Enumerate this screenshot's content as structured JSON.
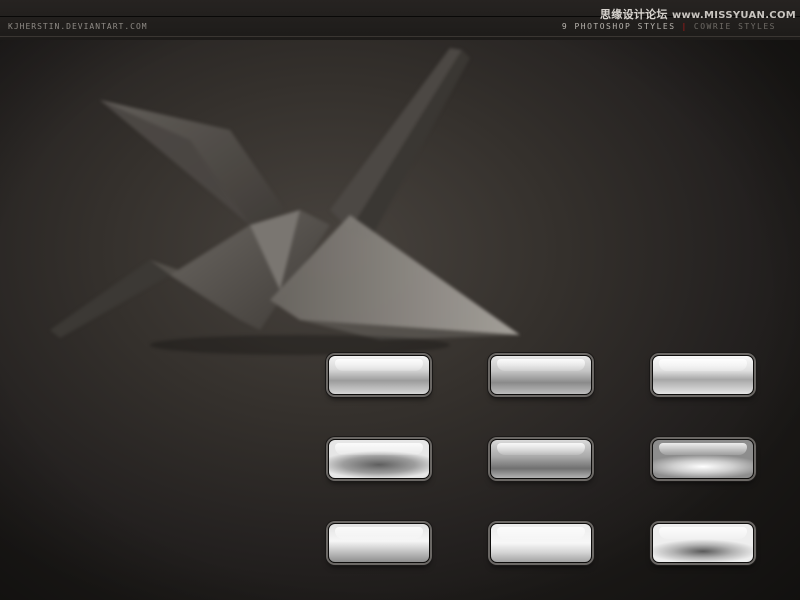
{
  "header": {
    "credit": "KJHERSTIN.DEVIANTART.COM",
    "title": "9 PHOTOSHOP STYLES",
    "separator": "|",
    "subtitle": "COWRIE STYLES",
    "watermark_cn": "思缘设计论坛",
    "watermark_url": "www.MISSYUAN.COM"
  },
  "style_buttons": [
    {
      "id": "style-1"
    },
    {
      "id": "style-2"
    },
    {
      "id": "style-3"
    },
    {
      "id": "style-4"
    },
    {
      "id": "style-5"
    },
    {
      "id": "style-6"
    },
    {
      "id": "style-7"
    },
    {
      "id": "style-8"
    },
    {
      "id": "style-9"
    }
  ],
  "colors": {
    "background": "#2f2b28",
    "accent_separator": "#b21919",
    "button_frame": "#6b6865"
  },
  "icons": {
    "hero": "origami-crane-icon"
  }
}
